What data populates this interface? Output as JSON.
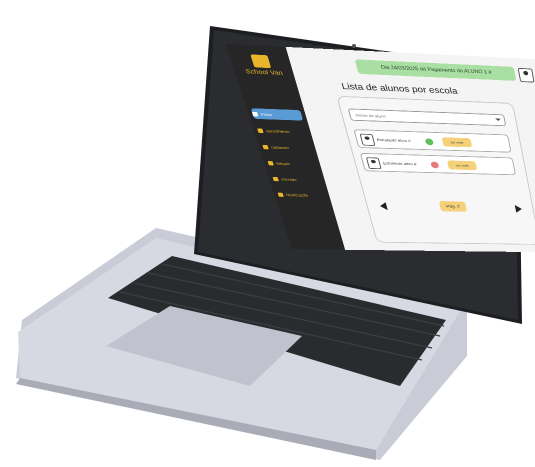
{
  "app": {
    "name": "School Van",
    "page_title": "Lista de alunos por escola"
  },
  "sidebar": {
    "items": [
      {
        "label": "Início",
        "active": true,
        "icon": "home-icon"
      },
      {
        "label": "vencimento",
        "active": false,
        "icon": "money-bag-icon"
      },
      {
        "label": "cadastro",
        "active": false,
        "icon": "user-add-icon"
      },
      {
        "label": "edição",
        "active": false,
        "icon": "edit-icon"
      },
      {
        "label": "escolas",
        "active": false,
        "icon": "school-icon"
      },
      {
        "label": "Notificação",
        "active": false,
        "icon": "notification-icon"
      }
    ]
  },
  "header": {
    "banner": "Dia 24/03/2025 dá Pagamento do ALUNO 1 é"
  },
  "search": {
    "placeholder": "Nome do aluno"
  },
  "students": [
    {
      "name": "Estudante ativo é",
      "status": "green",
      "action_label": "ver mais"
    },
    {
      "name": "Estudante ativo é",
      "status": "red",
      "action_label": "ver mais"
    }
  ],
  "pagination": {
    "current": "Pág. 2"
  },
  "colors": {
    "accent": "#e8b52c",
    "sidebar": "#262626",
    "active": "#5b9bd5",
    "status_green": "#5cc15c",
    "status_red": "#e77a7a",
    "banner": "#a9dfa2"
  }
}
